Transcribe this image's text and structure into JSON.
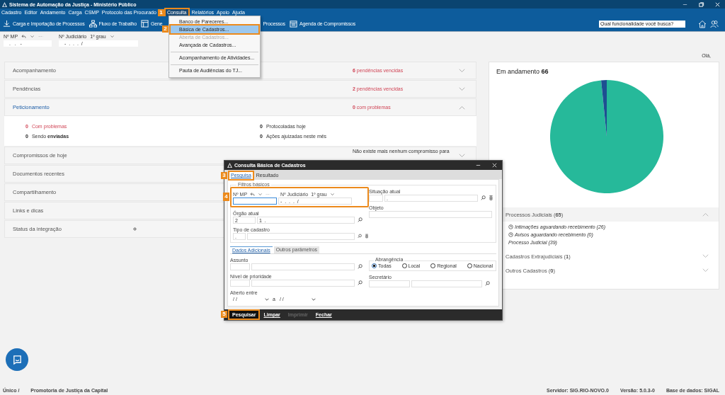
{
  "window": {
    "title": "Sistema de Automação da Justiça - Ministério Público"
  },
  "menu": [
    {
      "label": "Cadastro",
      "selected": false
    },
    {
      "label": "Editor",
      "selected": false
    },
    {
      "label": "Andamento",
      "selected": false
    },
    {
      "label": "Carga",
      "selected": false
    },
    {
      "label": "CSMP",
      "selected": false
    },
    {
      "label": "Protocolo das Procurado",
      "selected": false
    },
    {
      "label": "Consulta",
      "selected": true
    },
    {
      "label": "Relatórios",
      "selected": false
    },
    {
      "label": "Apoio",
      "selected": false
    },
    {
      "label": "Ajuda",
      "selected": false
    }
  ],
  "toolbar": [
    {
      "label": "Carga e Importação de Processos",
      "kind": "import"
    },
    {
      "label": "Fluxo de Trabalho",
      "kind": "flow"
    },
    {
      "label": "Gene",
      "kind": "manage"
    },
    {
      "label": "Processos",
      "kind": "none"
    },
    {
      "label": "Agenda de Compromissos",
      "kind": "calendar"
    }
  ],
  "search": {
    "placeholder": "Qual funcionalidade você busca?"
  },
  "record_bar": {
    "mp_label": "Nº MP",
    "judicial_label": "Nº Judiciário",
    "instance": "1º grau",
    "mp_value": ".   .   -",
    "judicial_value": "-  .  .  .  /"
  },
  "dropdown": {
    "items": [
      {
        "label": "Banco de Pareceres...",
        "selected": false,
        "disabled": false,
        "divider_before": false
      },
      {
        "label": "Básica de Cadastros...",
        "selected": true,
        "disabled": false,
        "divider_before": false
      },
      {
        "label": "Aberta de Cadastros...",
        "selected": false,
        "disabled": true,
        "divider_before": false
      },
      {
        "label": "Avançada de Cadastros...",
        "selected": false,
        "disabled": false,
        "divider_before": false
      },
      {
        "label": "Acompanhamento de Atividades...",
        "selected": false,
        "disabled": false,
        "divider_before": true
      },
      {
        "label": "Pauta de Audiências do TJ...",
        "selected": false,
        "disabled": false,
        "divider_before": true
      }
    ]
  },
  "greeting": "Olá,",
  "sections": [
    {
      "title": "Acompanhamento",
      "summary": "**6** pendências vencidas",
      "kind": "alert",
      "expanded": false
    },
    {
      "title": "Pendências",
      "summary": "**2** pendências vencidas",
      "kind": "alert",
      "expanded": false
    },
    {
      "title": "Peticionamento",
      "summary": "**0** com problemas",
      "kind": "alert",
      "expanded": true,
      "stats": [
        {
          "count": "0",
          "label": "Com problemas",
          "kind": "alert"
        },
        {
          "count": "0",
          "label": "Protocoladas hoje",
          "kind": "plain"
        },
        {
          "count": "0",
          "label": "Sendo **enviadas**",
          "kind": "plain"
        },
        {
          "count": "0",
          "label": "Ações ajuizadas neste mês",
          "kind": "plain"
        }
      ]
    },
    {
      "title": "Compromissos de hoje",
      "summary": "Não existe mais nenhum compromisso para",
      "kind": "plain",
      "expanded": false
    },
    {
      "title": "Documentos recentes",
      "kind": "plain"
    },
    {
      "title": "Compartilhamento",
      "kind": "plain"
    },
    {
      "title": "Links e dicas",
      "kind": "plain"
    },
    {
      "title": "Status da integração",
      "kind": "status"
    }
  ],
  "right_panel": {
    "title": "Em andamento **66**",
    "groups": [
      {
        "title": "Processos Judiciais (**65**)",
        "expanded": true,
        "items": [
          {
            "text": "Intimações aguardando recebimento (26)",
            "kind": "timed"
          },
          {
            "text": "Avisos aguardando recebimento (0)",
            "kind": "timed"
          },
          {
            "text": "Processo Judicial (39)",
            "kind": "plain"
          }
        ]
      },
      {
        "title": "Cadastros Extrajudiciais (**1**)",
        "expanded": false
      },
      {
        "title": "Outros Cadastros (**0**)",
        "expanded": false
      }
    ]
  },
  "dialog": {
    "title": "Consulta Básica de Cadastros",
    "tabs": [
      {
        "label": "Pesquisa",
        "selected": true
      },
      {
        "label": "Resultado",
        "selected": false
      }
    ],
    "group_title": "Filtros básicos",
    "mp_label": "Nº MP",
    "judicial_label": "Nº Judiciário",
    "instance": "1º grau",
    "judicial_value": "-  .  .  .  /",
    "status_label": "Situação atual",
    "status_value": ".",
    "organ_label": "Órgão atual",
    "organ_code": "2",
    "organ_value": "1  .",
    "object_label": "Objeto",
    "type_label": "Tipo de cadastro",
    "type_code": ".",
    "subtabs": [
      {
        "label": "Dados Adicionais",
        "selected": true
      },
      {
        "label": "Outros parâmetros",
        "selected": false
      }
    ],
    "subject_label": "Assunto",
    "priority_label": "Nível de prioridade",
    "opened_label": "Aberto entre",
    "date_from": "/ /",
    "date_sep": "a",
    "date_to": "/ /",
    "scope_label": "Abrangência",
    "scopes": [
      {
        "label": "Todas",
        "selected": true
      },
      {
        "label": "Local",
        "selected": false
      },
      {
        "label": "Regional",
        "selected": false
      },
      {
        "label": "Nacional",
        "selected": false
      }
    ],
    "secretary_label": "Secretário",
    "buttons": [
      {
        "label": "Pesquisar",
        "kind": "primary",
        "disabled": false
      },
      {
        "label": "Limpar",
        "kind": "plain",
        "disabled": false
      },
      {
        "label": "Imprimir",
        "kind": "plain",
        "disabled": true
      },
      {
        "label": "Fechar",
        "kind": "plain",
        "disabled": false
      }
    ]
  },
  "steps": [
    {
      "label": "1"
    },
    {
      "label": "2"
    },
    {
      "label": "3"
    },
    {
      "label": "4"
    },
    {
      "label": "5"
    }
  ],
  "status_bar": {
    "unit": "Único /",
    "office": "Promotoria de Justiça da Capital",
    "server": "Servidor: SIG.RIO-NOVO.0",
    "version": "Versão: 5.0.3-0",
    "database": "Base de dados: SIGAL"
  }
}
